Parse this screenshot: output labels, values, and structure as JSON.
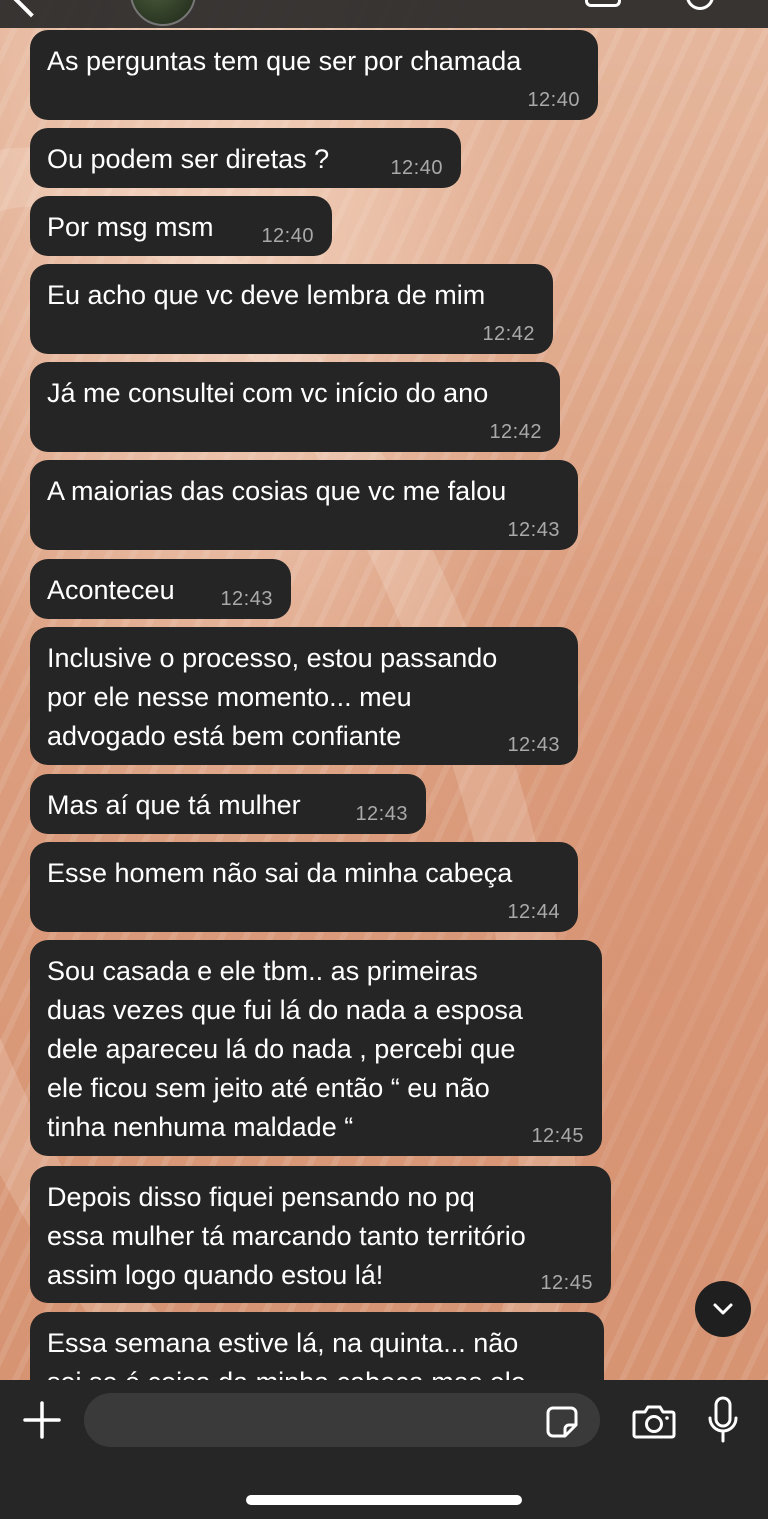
{
  "composer": {
    "placeholder": ""
  },
  "messages": [
    {
      "text": "As perguntas tem que ser por chamada",
      "time": "12:40"
    },
    {
      "text": "Ou podem ser diretas ?",
      "time": "12:40"
    },
    {
      "text": "Por msg msm",
      "time": "12:40"
    },
    {
      "text": "Eu acho que vc deve lembra de mim",
      "time": "12:42"
    },
    {
      "text": "Já me consultei com vc início do ano",
      "time": "12:42"
    },
    {
      "text": "A maiorias das cosias que vc me falou",
      "time": "12:43"
    },
    {
      "text": "Aconteceu",
      "time": "12:43"
    },
    {
      "text": "Inclusive o processo, estou passando\npor ele nesse momento... meu\nadvogado está bem confiante",
      "time": "12:43"
    },
    {
      "text": "Mas aí que tá mulher",
      "time": "12:43"
    },
    {
      "text": "Esse homem não sai da minha cabeça",
      "time": "12:44"
    },
    {
      "text": "Sou casada e ele tbm.. as primeiras\nduas vezes que fui lá do nada a esposa\ndele apareceu lá do nada , percebi que\nele ficou sem jeito até então “ eu não\ntinha nenhuma maldade “",
      "time": "12:45"
    },
    {
      "text": "Depois disso fiquei pensando no pq\nessa mulher tá marcando tanto território\nassim logo quando estou lá!",
      "time": "12:45"
    },
    {
      "text": "Essa semana estive lá, na quinta... não\nsei se é coisa da minha cabeça mas ele",
      "time": ""
    }
  ],
  "icons": {
    "back": "chevron-left-icon",
    "scroll_down": "chevron-down-icon",
    "attach": "plus-icon",
    "sticker": "sticker-icon",
    "camera": "camera-icon",
    "mic": "microphone-icon"
  },
  "colors": {
    "bubble": "#252525",
    "time": "#a9a9a9",
    "bar": "#262626"
  }
}
